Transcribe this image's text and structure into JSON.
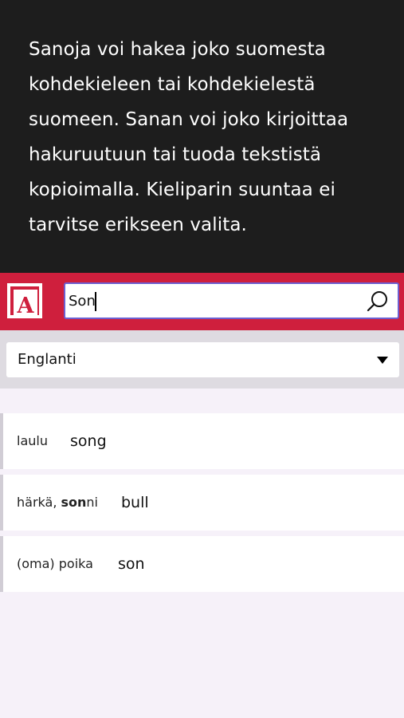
{
  "intro": {
    "lines": [
      "Sanoja voi hakea joko suomesta",
      "kohdekieleen tai kohdekielestä",
      "suomeen. Sanan voi joko kirjoittaa",
      "hakuruutuun tai tuoda tekstistä",
      "kopioimalla. Kieliparin suuntaa ei",
      "tarvitse erikseen valita."
    ]
  },
  "header": {
    "logo_letter": "A",
    "search_value": "Son",
    "search_icon": "search-icon"
  },
  "language": {
    "selected": "Englanti"
  },
  "results": [
    {
      "source_plain": "laulu",
      "source_bold": "",
      "source_rest": "",
      "target": "song"
    },
    {
      "source_plain": "härkä, ",
      "source_bold": "son",
      "source_rest": "ni",
      "target": "bull"
    },
    {
      "source_plain": "(oma) poika",
      "source_bold": "",
      "source_rest": "",
      "target": "son"
    }
  ],
  "colors": {
    "intro_bg": "#1d1d1d",
    "brand_red": "#cf1f3d",
    "input_border": "#6d5fd0",
    "page_bg": "#f6f1f9"
  }
}
